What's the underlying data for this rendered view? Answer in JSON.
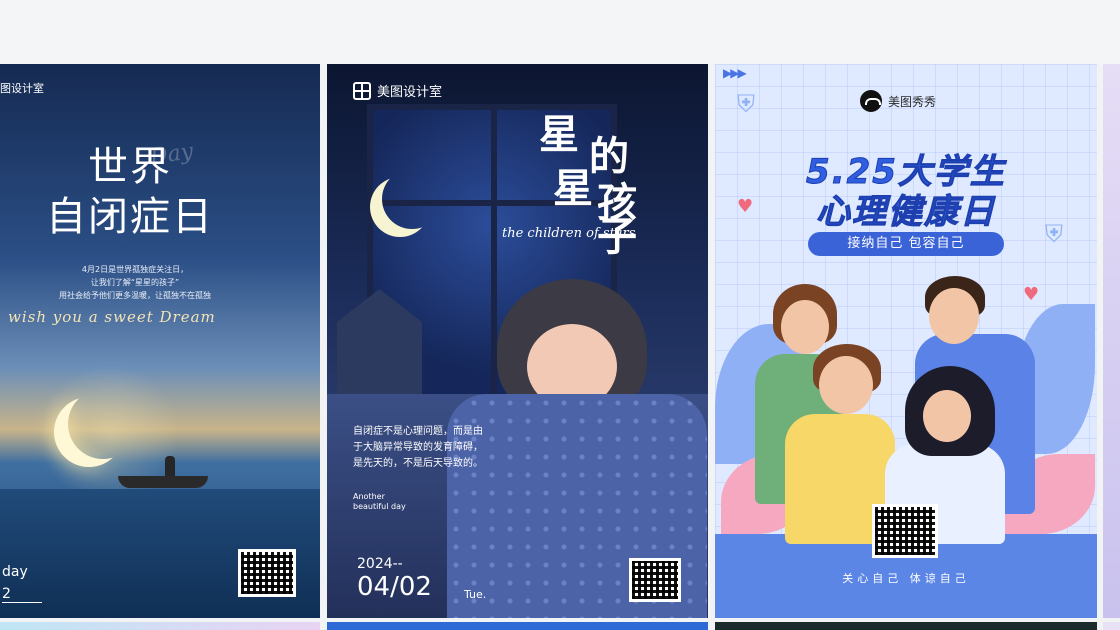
{
  "cards": [
    {
      "brand": "图设计室",
      "title_line1": "世界",
      "title_line2": "自闭症日",
      "background_script": "Day",
      "info_lines": [
        "4月2日是世界孤独症关注日，",
        "让我们了解“星星的孩子”",
        "用社会给予他们更多温暖，让孤独不在孤独"
      ],
      "script_text": "wish you a sweet Dream",
      "footer_line1": "day",
      "footer_line2": "2"
    },
    {
      "brand": "美图设计室",
      "title_chars": [
        "星",
        "的",
        "星",
        "孩",
        "子"
      ],
      "script_text": "the children of stars",
      "body_text": "自闭症不是心理问题，而是由于大脑异常导致的发育障碍，是先天的，不是后天导致的。",
      "small_text": "Another beautiful day",
      "year": "2024--",
      "date": "04/02",
      "weekday": "Tue."
    },
    {
      "brand": "美图秀秀",
      "arrows": "▶▶▶",
      "title_line1": "5.25大学生",
      "title_line2": "心理健康日",
      "pill_text": "接纳自己  包容自己",
      "slogan": "关心自己  体谅自己"
    }
  ],
  "colors": {
    "card3_title": "#2f5fe0",
    "card3_pill": "#3a63d8",
    "card3_bottom": "#5b86e6"
  },
  "icons": [
    "grid-logo-icon",
    "meitu-logo-icon",
    "shield-plus-icon",
    "heart-icon",
    "qr-code-icon"
  ]
}
